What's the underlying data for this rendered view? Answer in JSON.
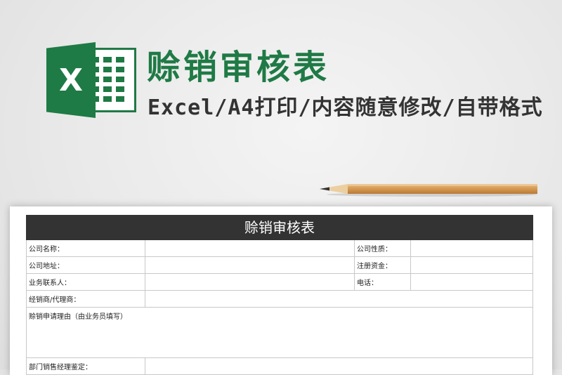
{
  "logo": {
    "letter": "X"
  },
  "headline": "赊销审核表",
  "subline": "Excel/A4打印/内容随意修改/自带格式",
  "sheet": {
    "title": "赊销审核表",
    "rows": [
      {
        "label1": "公司名称：",
        "label2": "公司性质："
      },
      {
        "label1": "公司地址：",
        "label2": "注册资金："
      },
      {
        "label1": "业务联系人：",
        "label2": "电话："
      },
      {
        "label1": "经销商/代理商："
      },
      {
        "label1": "赊销申请理由（由业务员填写）"
      },
      {
        "label1": "部门销售经理鉴定："
      }
    ]
  },
  "colors": {
    "brand_green": "#1f7a45",
    "title_bar": "#333333"
  }
}
